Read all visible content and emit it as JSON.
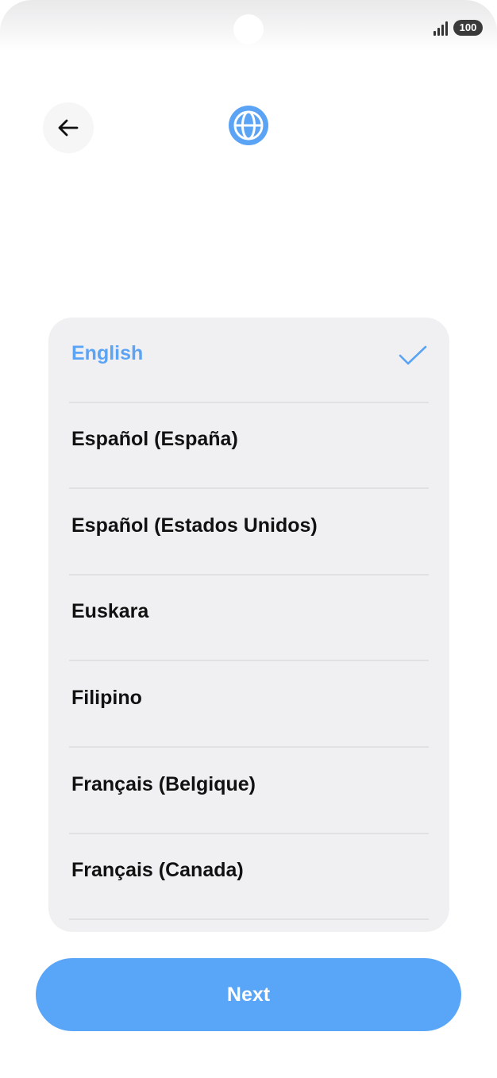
{
  "status_bar": {
    "battery": "100",
    "signal_icon": "signal-bars-icon"
  },
  "header": {
    "back_icon": "arrow-left-icon",
    "globe_icon": "globe-icon"
  },
  "languages": [
    {
      "label": "English",
      "selected": true
    },
    {
      "label": "Español (España)",
      "selected": false
    },
    {
      "label": "Español (Estados Unidos)",
      "selected": false
    },
    {
      "label": "Euskara",
      "selected": false
    },
    {
      "label": "Filipino",
      "selected": false
    },
    {
      "label": "Français (Belgique)",
      "selected": false
    },
    {
      "label": "Français (Canada)",
      "selected": false
    }
  ],
  "next_button": {
    "label": "Next"
  },
  "colors": {
    "accent": "#5ba4f5",
    "button": "#59a6f8",
    "card": "#f0f0f2",
    "text": "#111111"
  }
}
